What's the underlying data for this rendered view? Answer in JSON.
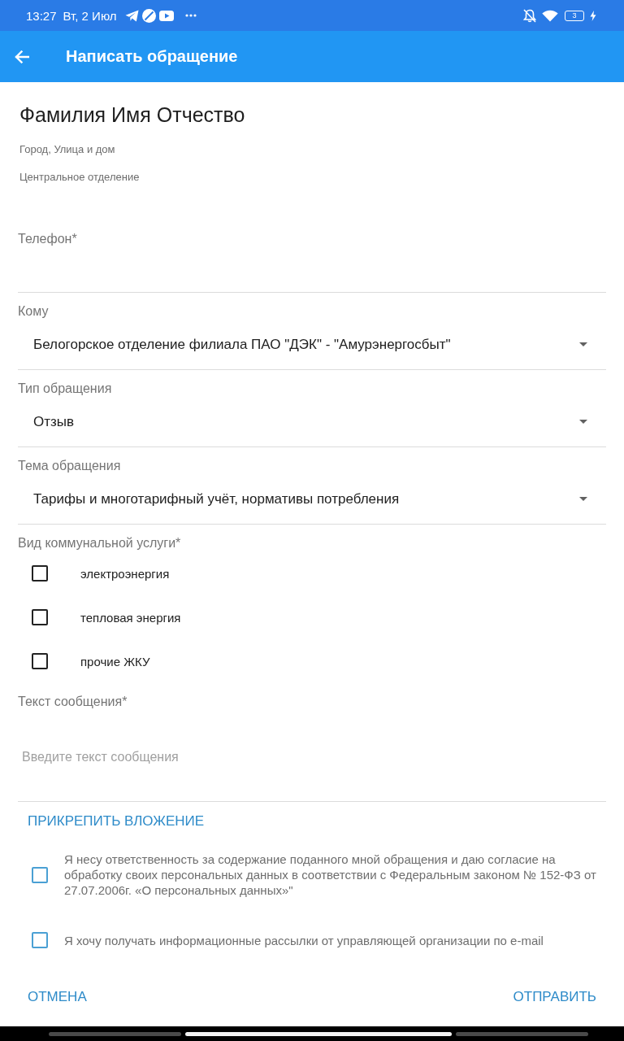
{
  "status_bar": {
    "time": "13:27",
    "date": "Вт, 2 Июл",
    "battery": "3"
  },
  "app_bar": {
    "title": "Написать обращение"
  },
  "profile": {
    "name": "Фамилия Имя Отчество",
    "address": "Город, Улица и дом",
    "department": "Центральное отделение"
  },
  "fields": [
    {
      "kind": "text",
      "label": "Телефон*"
    },
    {
      "kind": "dropdown",
      "label": "Кому",
      "value": "Белогорское отделение филиала ПАО \"ДЭК\" - \"Амурэнергосбыт\""
    },
    {
      "kind": "dropdown",
      "label": "Тип обращения",
      "value": "Отзыв"
    },
    {
      "kind": "dropdown",
      "label": "Тема обращения",
      "value": "Тарифы и многотарифный учёт, нормативы потребления"
    },
    {
      "kind": "checkboxes",
      "label": "Вид коммунальной услуги*",
      "options": [
        {
          "label": "электроэнергия",
          "checked": false
        },
        {
          "label": "тепловая энергия",
          "checked": false
        },
        {
          "label": "прочие ЖКУ",
          "checked": false
        }
      ]
    },
    {
      "kind": "textarea",
      "label": "Текст сообщения*",
      "placeholder": "Введите текст сообщения"
    }
  ],
  "attach_link": "ПРИКРЕПИТЬ ВЛОЖЕНИЕ",
  "consents": [
    {
      "text": "Я несу ответственность за содержание поданного мной обращения и даю согласие на обработку своих персональных данных в соответствии с Федеральным законом № 152-ФЗ от 27.07.2006г. «О персональных данных»\"",
      "checked": false
    },
    {
      "text": "Я хочу получать информационные рассылки от управляющей организации по e-mail",
      "checked": false
    }
  ],
  "actions": [
    {
      "label": "ОТМЕНА"
    },
    {
      "label": "ОТПРАВИТЬ"
    }
  ]
}
